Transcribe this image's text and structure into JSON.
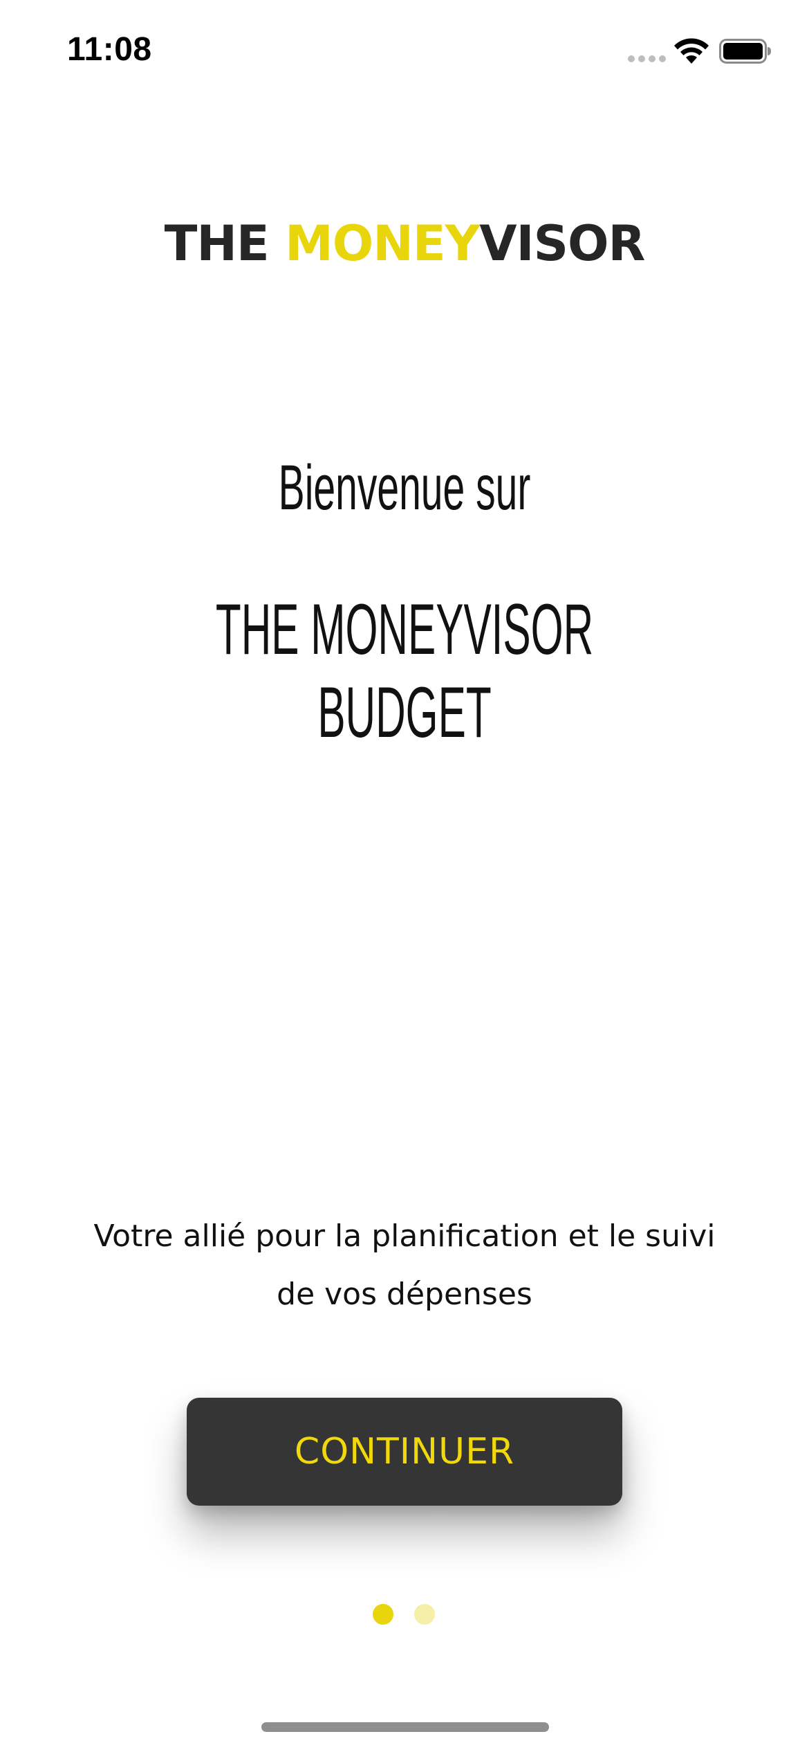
{
  "status_bar": {
    "time": "11:08"
  },
  "logo": {
    "part1": "THE ",
    "part2": "MONEY",
    "part3": "VISOR"
  },
  "welcome": {
    "line1": "Bienvenue sur",
    "line2": "THE MONEYVISOR BUDGET"
  },
  "tagline": {
    "text": "Votre allié pour la planification et le suivi de vos dépenses"
  },
  "continue_button": {
    "label": "CONTINUER"
  },
  "page_indicator": {
    "current": 1,
    "total": 2
  },
  "colors": {
    "accent_yellow": "#e8d50b",
    "button_bg": "#353535",
    "text_dark": "#262626"
  },
  "icons": [
    "signal-icon",
    "wifi-icon",
    "battery-icon"
  ]
}
